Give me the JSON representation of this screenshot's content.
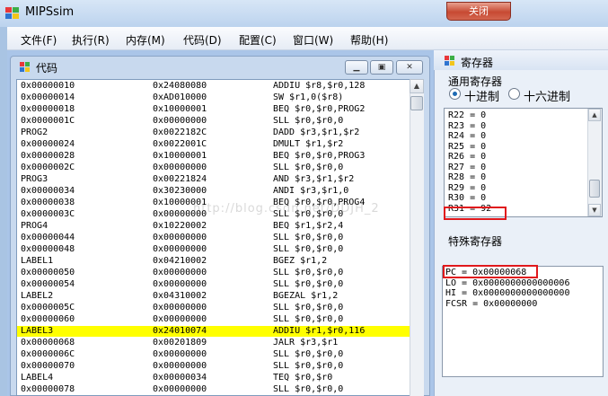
{
  "app": {
    "title": "MIPSsim",
    "close_label": "关闭"
  },
  "menu": [
    "文件(F)",
    "执行(R)",
    "内存(M)",
    "代码(D)",
    "配置(C)",
    "窗口(W)",
    "帮助(H)"
  ],
  "code_window": {
    "title": "代码",
    "rows": [
      {
        "label": "0x00000010",
        "code": "0x24080080",
        "asm": "ADDIU $r8,$r0,128",
        "highlight": false
      },
      {
        "label": "0x00000014",
        "code": "0xAD010000",
        "asm": "SW $r1,0($r8)",
        "highlight": false
      },
      {
        "label": "0x00000018",
        "code": "0x10000001",
        "asm": "BEQ $r0,$r0,PROG2",
        "highlight": false
      },
      {
        "label": "0x0000001C",
        "code": "0x00000000",
        "asm": "SLL $r0,$r0,0",
        "highlight": false
      },
      {
        "label": "PROG2",
        "code": "0x0022182C",
        "asm": "DADD $r3,$r1,$r2",
        "highlight": false
      },
      {
        "label": "0x00000024",
        "code": "0x0022001C",
        "asm": "DMULT $r1,$r2",
        "highlight": false
      },
      {
        "label": "0x00000028",
        "code": "0x10000001",
        "asm": "BEQ $r0,$r0,PROG3",
        "highlight": false
      },
      {
        "label": "0x0000002C",
        "code": "0x00000000",
        "asm": "SLL $r0,$r0,0",
        "highlight": false
      },
      {
        "label": "PROG3",
        "code": "0x00221824",
        "asm": "AND $r3,$r1,$r2",
        "highlight": false
      },
      {
        "label": "0x00000034",
        "code": "0x30230000",
        "asm": "ANDI $r3,$r1,0",
        "highlight": false
      },
      {
        "label": "0x00000038",
        "code": "0x10000001",
        "asm": "BEQ $r0,$r0,PROG4",
        "highlight": false
      },
      {
        "label": "0x0000003C",
        "code": "0x00000000",
        "asm": "SLL $r0,$r0,0",
        "highlight": false
      },
      {
        "label": "PROG4",
        "code": "0x10220002",
        "asm": "BEQ $r1,$r2,4",
        "highlight": false
      },
      {
        "label": "0x00000044",
        "code": "0x00000000",
        "asm": "SLL $r0,$r0,0",
        "highlight": false
      },
      {
        "label": "0x00000048",
        "code": "0x00000000",
        "asm": "SLL $r0,$r0,0",
        "highlight": false
      },
      {
        "label": "LABEL1",
        "code": "0x04210002",
        "asm": "BGEZ $r1,2",
        "highlight": false
      },
      {
        "label": "0x00000050",
        "code": "0x00000000",
        "asm": "SLL $r0,$r0,0",
        "highlight": false
      },
      {
        "label": "0x00000054",
        "code": "0x00000000",
        "asm": "SLL $r0,$r0,0",
        "highlight": false
      },
      {
        "label": "LABEL2",
        "code": "0x04310002",
        "asm": "BGEZAL $r1,2",
        "highlight": false
      },
      {
        "label": "0x0000005C",
        "code": "0x00000000",
        "asm": "SLL $r0,$r0,0",
        "highlight": false
      },
      {
        "label": "0x00000060",
        "code": "0x00000000",
        "asm": "SLL $r0,$r0,0",
        "highlight": false
      },
      {
        "label": "LABEL3",
        "code": "0x24010074",
        "asm": "ADDIU $r1,$r0,116",
        "highlight": true
      },
      {
        "label": "0x00000068",
        "code": "0x00201809",
        "asm": "JALR $r3,$r1",
        "highlight": false
      },
      {
        "label": "0x0000006C",
        "code": "0x00000000",
        "asm": "SLL $r0,$r0,0",
        "highlight": false
      },
      {
        "label": "0x00000070",
        "code": "0x00000000",
        "asm": "SLL $r0,$r0,0",
        "highlight": false
      },
      {
        "label": "LABEL4",
        "code": "0x00000034",
        "asm": "TEQ $r0,$r0",
        "highlight": false
      },
      {
        "label": "0x00000078",
        "code": "0x00000000",
        "asm": "SLL $r0,$r0,0",
        "highlight": false
      }
    ]
  },
  "register_panel": {
    "title": "寄存器",
    "general_label": "通用寄存器",
    "radio_decimal": "十进制",
    "radio_hex": "十六进制",
    "radio_selected": "decimal",
    "general_rows": [
      "R22 = 0",
      "R23 = 0",
      "R24 = 0",
      "R25 = 0",
      "R26 = 0",
      "R27 = 0",
      "R28 = 0",
      "R29 = 0",
      "R30 = 0",
      "R31 = 92"
    ],
    "special_label": "特殊寄存器",
    "special_rows": [
      "PC = 0x00000068",
      "LO = 0x0000000000000006",
      "HI = 0x0000000000000000",
      "FCSR = 0x00000000"
    ]
  },
  "watermark": "http://blog.csdn.net/DDJH_2"
}
